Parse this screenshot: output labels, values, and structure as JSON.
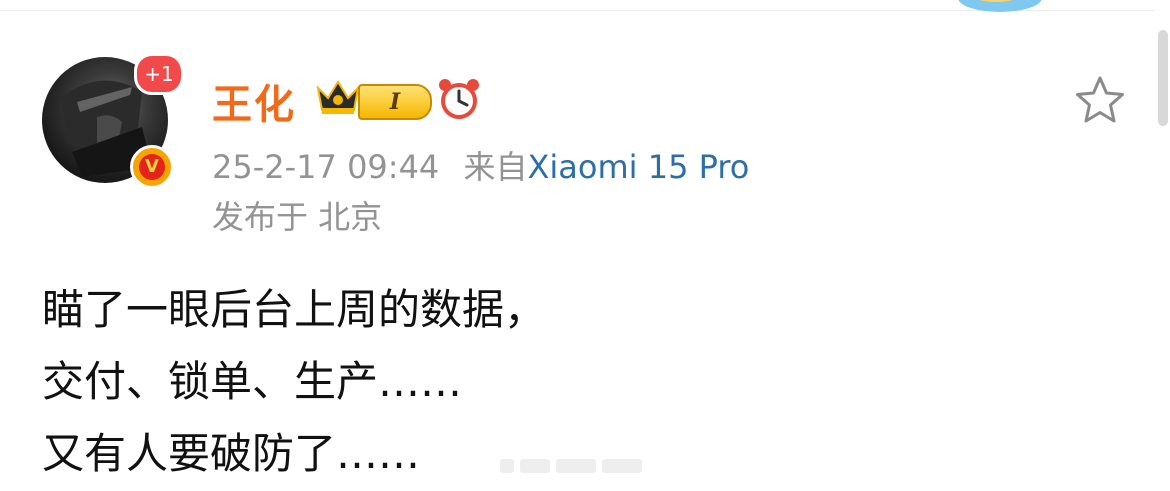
{
  "post": {
    "user": {
      "name": "王化",
      "follow_badge": "+1",
      "verified_mark": "V",
      "level": "I"
    },
    "meta": {
      "time": "25-2-17 09:44",
      "source_prefix": "来自",
      "device": "Xiaomi 15 Pro",
      "location": "发布于 北京"
    },
    "body_lines": [
      "瞄了一眼后台上周的数据，",
      "交付、锁单、生产……",
      "又有人要破防了……"
    ]
  },
  "icons": [
    "crown-icon",
    "clock-icon",
    "star-icon",
    "verified-icon"
  ],
  "colors": {
    "username": "#f06a1a",
    "device_link": "#2e6ea8",
    "meta": "#939393",
    "badge_red": "#f24a4a"
  }
}
